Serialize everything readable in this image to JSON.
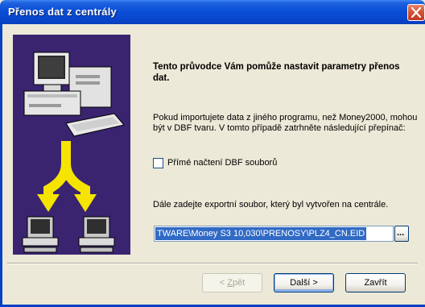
{
  "window": {
    "title": "Přenos dat z centrály"
  },
  "content": {
    "heading": "Tento průvodce Vám pomůže nastavit parametry přenos dat.",
    "para1": "Pokud importujete data z jiného programu, než Money2000, mohou být v DBF tvaru. V tomto případě zatrhněte následující přepínač:",
    "checkbox_label": "Přímé načtení DBF souborů",
    "checkbox_checked": false,
    "para2": "Dále zadejte exportní soubor, který byl vytvořen na centrále.",
    "path_value": "TWARE\\Money S3 10,030\\PRENOSY\\PLZ4_CN.EID",
    "browse_label": "..."
  },
  "buttons": {
    "back_prefix": "< ",
    "back_key": "Z",
    "back_rest": "pět",
    "next_label": "Další >",
    "close_label": "Zavřít"
  },
  "icons": [
    "close-icon",
    "computer-illustration",
    "arrow-split-illustration"
  ],
  "colors": {
    "titlebar": "#0A4FD6",
    "face": "#ECE9D8",
    "selection": "#316AC5",
    "art_bg": "#3A2470",
    "arrow": "#F5E400"
  }
}
